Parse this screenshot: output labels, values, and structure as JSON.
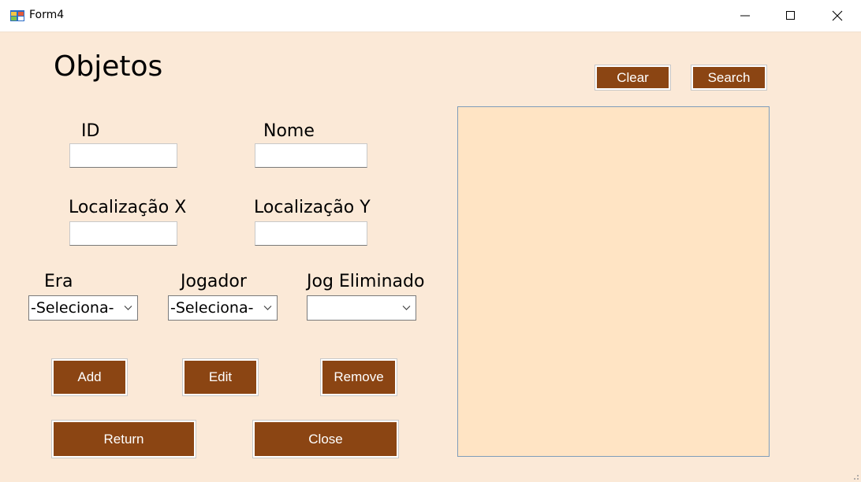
{
  "window": {
    "title": "Form4",
    "icon": "app-form-icon",
    "controls": [
      "minimize-icon",
      "maximize-icon",
      "close-icon"
    ]
  },
  "form": {
    "heading": "Objetos",
    "fields": {
      "id": {
        "label": "ID",
        "value": ""
      },
      "nome": {
        "label": "Nome",
        "value": ""
      },
      "loc_x": {
        "label": "Localização X",
        "value": ""
      },
      "loc_y": {
        "label": "Localização Y",
        "value": ""
      }
    },
    "combos": {
      "era": {
        "label": "Era",
        "selected": "-Seleciona-"
      },
      "jogador": {
        "label": "Jogador",
        "selected": "-Seleciona-"
      },
      "jog_eliminado": {
        "label": "Jog Eliminado",
        "selected": ""
      }
    },
    "buttons": {
      "add": "Add",
      "edit": "Edit",
      "remove": "Remove",
      "return": "Return",
      "close": "Close",
      "clear": "Clear",
      "search": "Search"
    }
  },
  "colors": {
    "background": "#fbe9d7",
    "button": "#8b4513",
    "button_text": "#ffffff",
    "list_panel": "#ffe4c4"
  }
}
